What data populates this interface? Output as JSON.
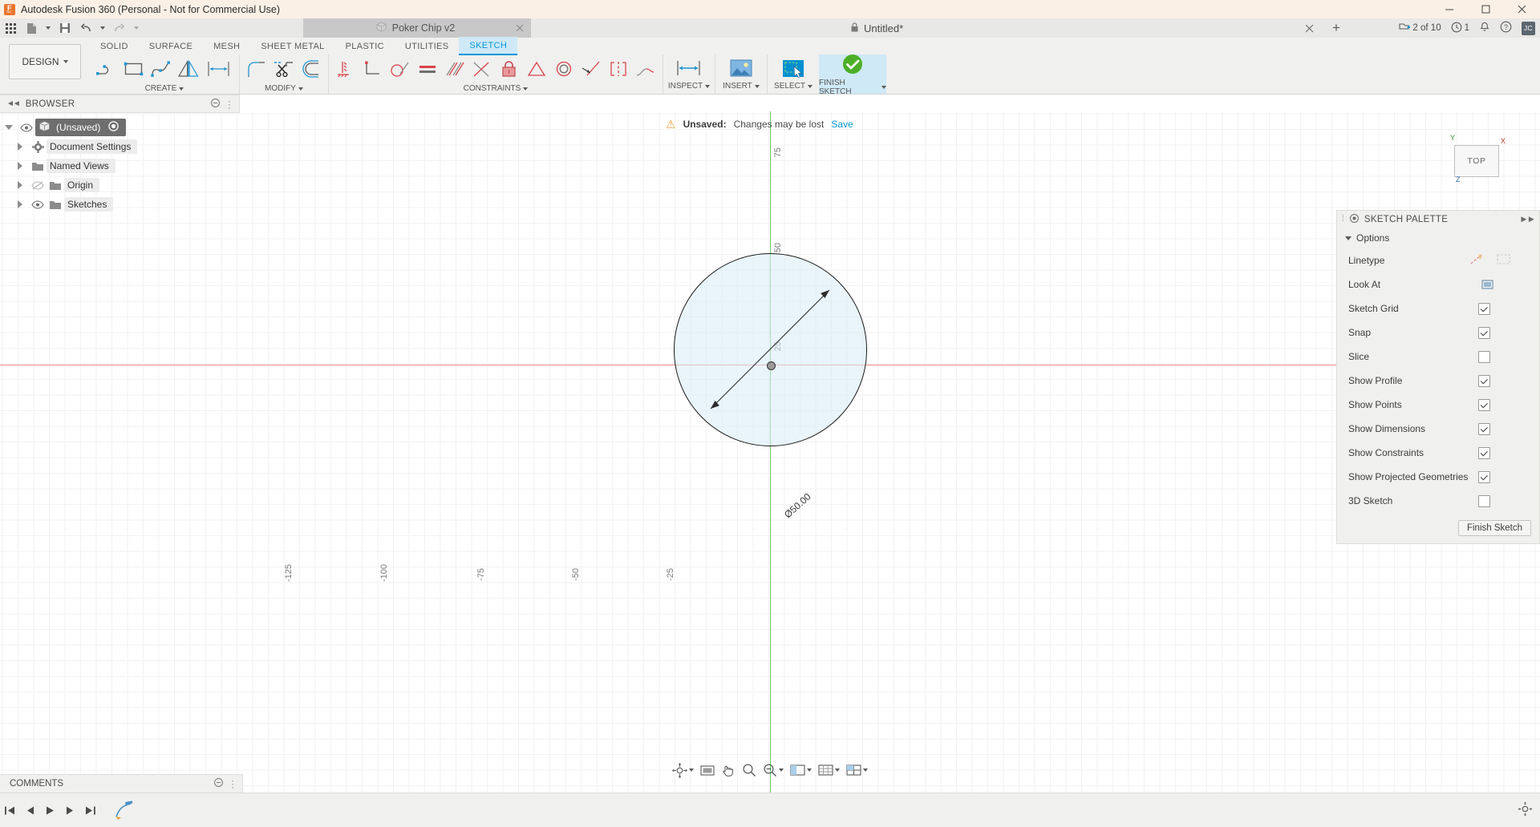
{
  "titlebar": {
    "app_title": "Autodesk Fusion 360 (Personal - Not for Commercial Use)",
    "logo": "fusion-360-logo",
    "minimize": "minimize-icon",
    "maximize": "maximize-icon",
    "close": "close-icon"
  },
  "quickaccess": {
    "grid_menu": "app-grid-icon",
    "new_file": "new-file-icon",
    "save": "save-icon",
    "undo": "undo-icon",
    "redo": "redo-icon"
  },
  "doc_tabs": [
    {
      "label": "Poker Chip v2",
      "active": false,
      "closable": true
    },
    {
      "label": "Untitled*",
      "active": true,
      "closable": true,
      "locked": true
    }
  ],
  "tab_add_label": "+",
  "header_right": {
    "job_status": "2 of 10",
    "notifications_count": "1",
    "job_icon": "upload-job-icon",
    "clock_icon": "clock-icon",
    "bell_icon": "bell-icon",
    "help_icon": "help-icon",
    "avatar_initials": "JC"
  },
  "ribbon": {
    "workspace_label": "DESIGN",
    "tabs": [
      {
        "label": "SOLID",
        "active": false
      },
      {
        "label": "SURFACE",
        "active": false
      },
      {
        "label": "MESH",
        "active": false
      },
      {
        "label": "SHEET METAL",
        "active": false
      },
      {
        "label": "PLASTIC",
        "active": false
      },
      {
        "label": "UTILITIES",
        "active": false
      },
      {
        "label": "SKETCH",
        "active": true
      }
    ],
    "groups": [
      {
        "label": "CREATE",
        "dropdown": true,
        "tools": [
          "line-icon",
          "rectangle-icon",
          "spline-icon",
          "mirror-icon",
          "sketch-dimension-icon"
        ]
      },
      {
        "label": "MODIFY",
        "dropdown": true,
        "tools": [
          "fillet-icon",
          "trim-icon",
          "offset-icon"
        ]
      },
      {
        "label": "CONSTRAINTS",
        "dropdown": true,
        "tools": [
          "horizontal-vertical-constraint-icon",
          "perpendicular-constraint-icon",
          "tangent-constraint-icon",
          "equal-constraint-icon",
          "parallel-constraint-icon",
          "perpendicular-icon",
          "fix-unfix-constraint-icon",
          "midpoint-constraint-icon",
          "concentric-constraint-icon",
          "collinear-constraint-icon",
          "symmetry-constraint-icon",
          "curvature-constraint-icon"
        ]
      },
      {
        "label": "INSPECT",
        "dropdown": true,
        "tools": [
          "measure-icon"
        ]
      },
      {
        "label": "INSERT",
        "dropdown": true,
        "tools": [
          "insert-image-icon"
        ]
      },
      {
        "label": "SELECT",
        "dropdown": true,
        "tools": [
          "select-window-icon"
        ]
      },
      {
        "label": "FINISH SKETCH",
        "dropdown": true,
        "tools": [
          "finish-sketch-check-icon"
        ],
        "highlighted": true
      }
    ]
  },
  "browser": {
    "title": "BROWSER",
    "collapse_icon": "collapse-left-icon",
    "settings_icon": "panel-settings-icon",
    "tree": [
      {
        "label": "(Unsaved)",
        "depth": 0,
        "selected": true,
        "icon": "component-cube-icon",
        "eye": true,
        "expander": "down",
        "radio": true
      },
      {
        "label": "Document Settings",
        "depth": 1,
        "selected": false,
        "icon": "gear-icon",
        "eye": false,
        "expander": "right"
      },
      {
        "label": "Named Views",
        "depth": 1,
        "selected": false,
        "icon": "folder-icon",
        "eye": false,
        "expander": "right"
      },
      {
        "label": "Origin",
        "depth": 1,
        "selected": false,
        "icon": "folder-icon",
        "eye": true,
        "eye_off": true,
        "expander": "right"
      },
      {
        "label": "Sketches",
        "depth": 1,
        "selected": false,
        "icon": "folder-icon",
        "eye": true,
        "expander": "right"
      }
    ]
  },
  "banner": {
    "warn_icon": "warning-icon",
    "status_label": "Unsaved:",
    "message": "Changes may be lost",
    "action_label": "Save"
  },
  "viewcube": {
    "face_label": "TOP",
    "axis_x": "X",
    "axis_y": "Y",
    "axis_z": "Z"
  },
  "canvas": {
    "dimension_text": "Ø50.00",
    "ruler_ticks_x": [
      "-125",
      "-100",
      "-75",
      "-50",
      "-25"
    ],
    "ruler_ticks_y": [
      "75",
      "50",
      "25"
    ],
    "x_axis_color": "#f08c8c",
    "y_axis_color": "#72c472",
    "profile_fill": "#d8ecf7",
    "sketch_line_color": "#1b1b1b"
  },
  "palette": {
    "title": "SKETCH PALETTE",
    "expand_icon": "expand-right-icon",
    "section_label": "Options",
    "rows": [
      {
        "label": "Linetype",
        "type": "buttons",
        "icons": [
          "construction-line-icon",
          "centerline-icon"
        ]
      },
      {
        "label": "Look At",
        "type": "button",
        "icons": [
          "look-at-icon"
        ]
      },
      {
        "label": "Sketch Grid",
        "type": "checkbox",
        "checked": true
      },
      {
        "label": "Snap",
        "type": "checkbox",
        "checked": true
      },
      {
        "label": "Slice",
        "type": "checkbox",
        "checked": false
      },
      {
        "label": "Show Profile",
        "type": "checkbox",
        "checked": true
      },
      {
        "label": "Show Points",
        "type": "checkbox",
        "checked": true
      },
      {
        "label": "Show Dimensions",
        "type": "checkbox",
        "checked": true
      },
      {
        "label": "Show Constraints",
        "type": "checkbox",
        "checked": true
      },
      {
        "label": "Show Projected Geometries",
        "type": "checkbox",
        "checked": true
      },
      {
        "label": "3D Sketch",
        "type": "checkbox",
        "checked": false
      }
    ],
    "finish_button": "Finish Sketch"
  },
  "navbar": {
    "buttons": [
      {
        "name": "orbit-icon",
        "dropdown": true
      },
      {
        "name": "look-at-icon",
        "dropdown": false
      },
      {
        "name": "pan-icon",
        "dropdown": false
      },
      {
        "name": "zoom-icon",
        "dropdown": false
      },
      {
        "name": "zoom-fit-icon",
        "dropdown": true
      },
      {
        "name": "display-settings-icon",
        "dropdown": true
      },
      {
        "name": "grid-snap-icon",
        "dropdown": true
      },
      {
        "name": "viewports-icon",
        "dropdown": true
      }
    ]
  },
  "comments": {
    "title": "COMMENTS",
    "settings_icon": "panel-settings-icon"
  },
  "timeline": {
    "buttons": [
      "go-to-beginning-icon",
      "step-back-icon",
      "play-icon",
      "step-forward-icon",
      "go-to-end-icon"
    ],
    "features": [
      "sketch-feature-icon"
    ],
    "settings_icon": "timeline-settings-icon"
  }
}
